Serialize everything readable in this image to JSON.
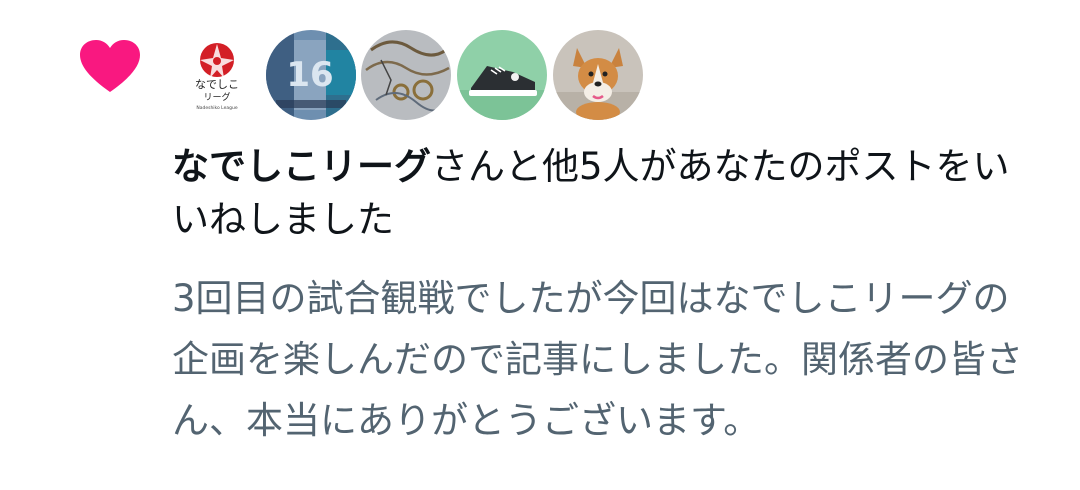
{
  "notification": {
    "type": "like",
    "heart_color": "#f91880",
    "liker_name": "なでしこリーグ",
    "message_rest": "さんと他5人があなたのポストをいいねしました",
    "post_text": "3回目の試合観戦でしたが今回はなでしこリーグの企画を楽しんだので記事にしました。関係者の皆さん、本当にありがとうございます。",
    "avatars": [
      {
        "name": "nadeshiko-league-avatar",
        "logo_text": "なでしこ",
        "logo_sub": "リーグ",
        "logo_caption": "Nadeshiko League"
      },
      {
        "name": "user-avatar-jersey",
        "jersey_number": "16"
      },
      {
        "name": "user-avatar-illustration"
      },
      {
        "name": "user-avatar-sneaker"
      },
      {
        "name": "user-avatar-corgi"
      }
    ]
  }
}
